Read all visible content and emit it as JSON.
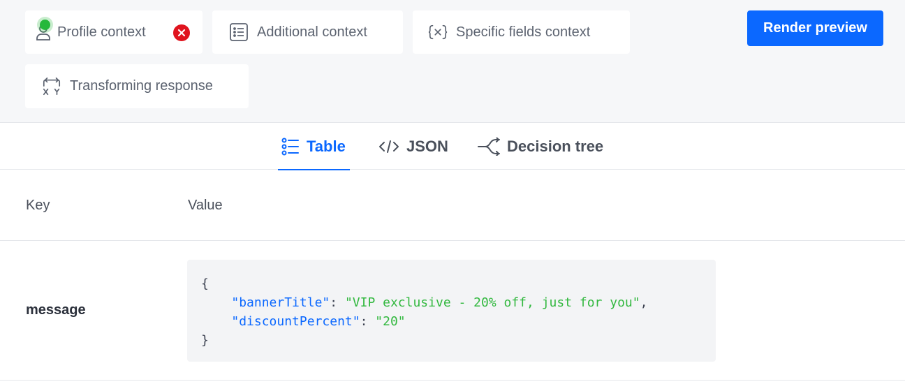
{
  "context_buttons": {
    "profile": {
      "label": "Profile context",
      "icon": "user-icon",
      "status_color": "#26b83b",
      "remove_icon": "close-circle-icon"
    },
    "additional": {
      "label": "Additional context",
      "icon": "list-icon"
    },
    "specific": {
      "label": "Specific fields context",
      "icon": "variable-icon"
    },
    "transforming": {
      "label": "Transforming response",
      "icon": "transform-icon"
    }
  },
  "render_button": {
    "label": "Render preview",
    "color": "#0b68ff"
  },
  "tabs": [
    {
      "label": "Table",
      "icon": "list-icon",
      "active": true
    },
    {
      "label": "JSON",
      "icon": "code-icon",
      "active": false
    },
    {
      "label": "Decision tree",
      "icon": "decision-tree-icon",
      "active": false
    }
  ],
  "table": {
    "headers": {
      "key": "Key",
      "value": "Value"
    },
    "rows": [
      {
        "key": "message",
        "value": {
          "open": "{",
          "close": "}",
          "entries": [
            {
              "key": "\"bannerTitle\"",
              "value": "\"VIP exclusive - 20% off, just for you\""
            },
            {
              "key": "\"discountPercent\"",
              "value": "\"20\""
            }
          ]
        }
      }
    ]
  },
  "colors": {
    "accent": "#0b68ff",
    "string_value": "#32b83f",
    "json_key": "#0b68ff",
    "danger": "#e0141e"
  }
}
